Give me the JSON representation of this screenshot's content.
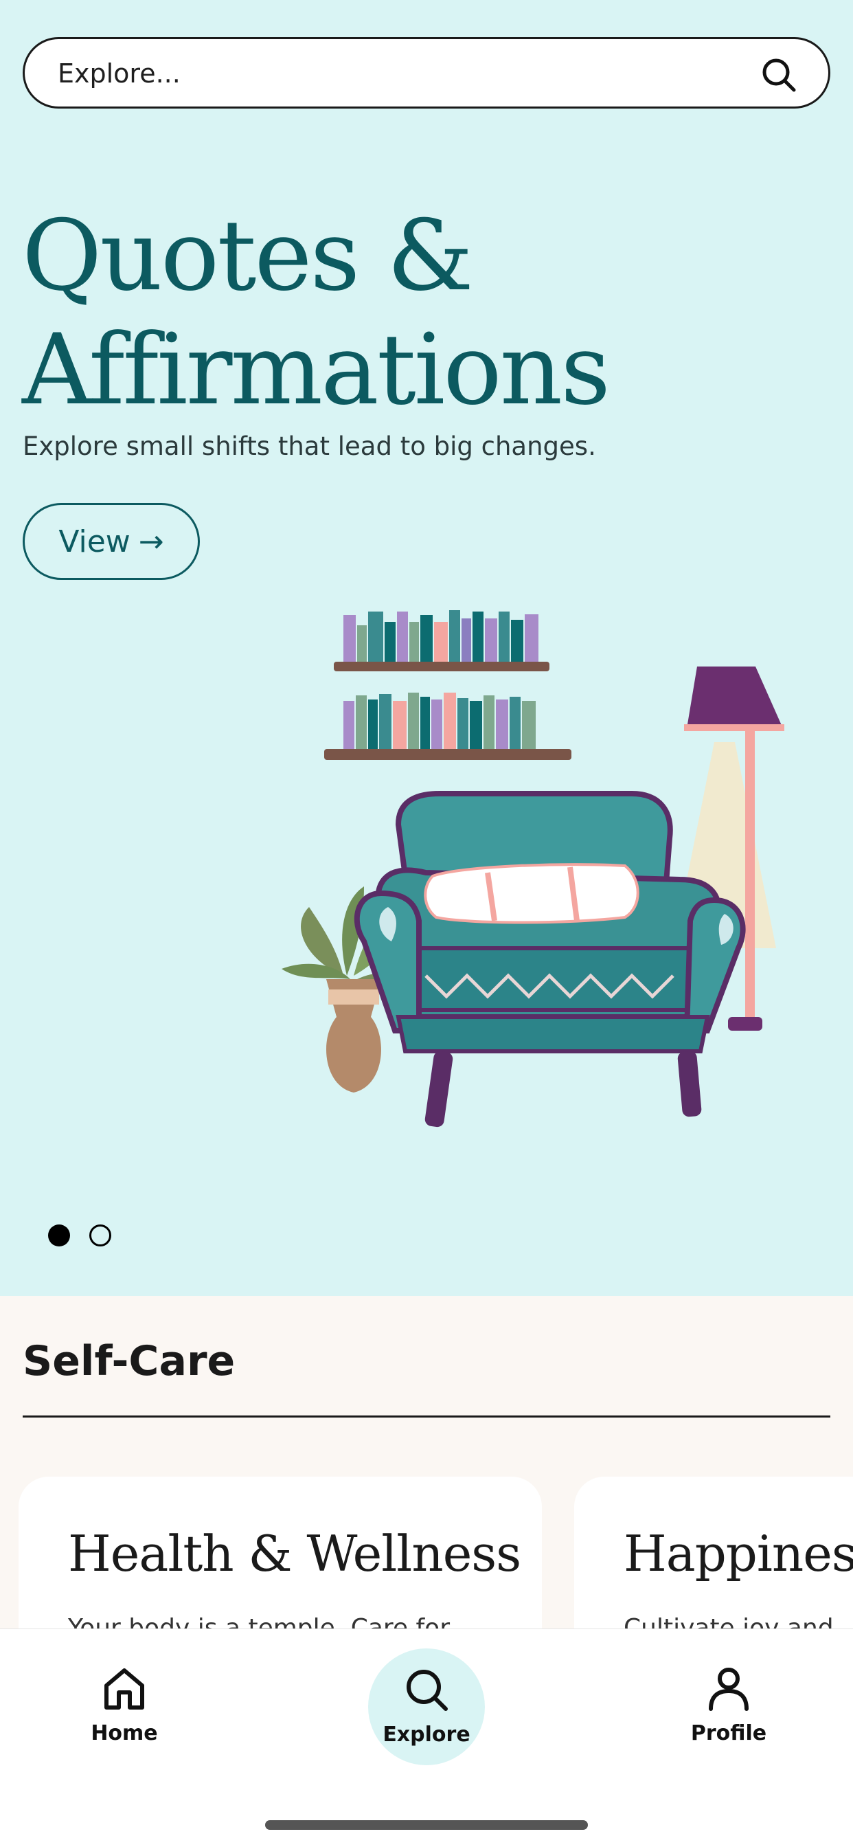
{
  "search": {
    "placeholder": "Explore..."
  },
  "hero": {
    "title_line1": "Quotes &",
    "title_line2": "Affirmations",
    "subtitle": "Explore small shifts that lead to big changes.",
    "view_button_label": "View",
    "view_button_arrow": "→",
    "carousel": {
      "total_slides": 2,
      "active_index": 0
    }
  },
  "section": {
    "title": "Self-Care",
    "cards": [
      {
        "title": "Health & Wellness",
        "description": "Your body is a temple. Care for"
      },
      {
        "title": "Happiness",
        "description": "Cultivate joy and"
      }
    ]
  },
  "tabbar": {
    "items": [
      {
        "label": "Home",
        "icon": "home-icon",
        "active": false
      },
      {
        "label": "Explore",
        "icon": "search-icon",
        "active": true
      },
      {
        "label": "Profile",
        "icon": "person-icon",
        "active": false
      }
    ]
  },
  "colors": {
    "hero_bg": "#d9f4f4",
    "brand_teal": "#0c5a60",
    "section_bg": "#fbf7f3"
  }
}
